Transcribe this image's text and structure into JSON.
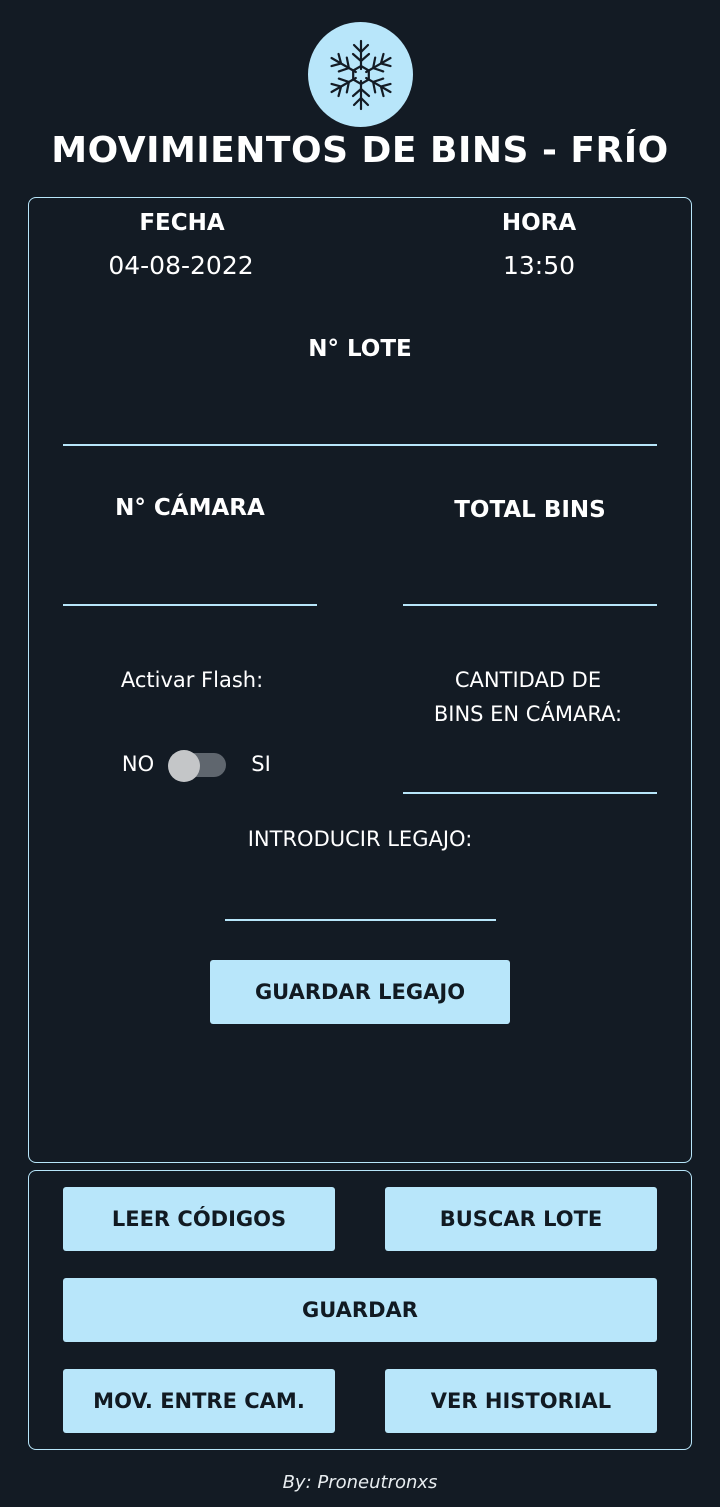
{
  "header": {
    "logo_icon": "snowflake-icon",
    "title": "MOVIMIENTOS DE BINS - FRÍO"
  },
  "form": {
    "fecha_label": "FECHA",
    "fecha_value": "04-08-2022",
    "hora_label": "HORA",
    "hora_value": "13:50",
    "lote_label": "N° LOTE",
    "lote_value": "",
    "camara_label": "N° CÁMARA",
    "camara_value": "",
    "total_bins_label": "TOTAL BINS",
    "total_bins_value": "",
    "flash_label": "Activar Flash:",
    "flash_off": "NO",
    "flash_on": "SI",
    "flash_enabled": false,
    "cantidad_label_line1": "CANTIDAD DE",
    "cantidad_label_line2": "BINS EN CÁMARA:",
    "cantidad_value": "",
    "legajo_label": "INTRODUCIR LEGAJO:",
    "legajo_value": "",
    "guardar_legajo": "GUARDAR LEGAJO"
  },
  "actions": {
    "leer_codigos": "LEER CÓDIGOS",
    "buscar_lote": "BUSCAR LOTE",
    "guardar": "GUARDAR",
    "mov_entre_cam": "MOV. ENTRE CAM.",
    "ver_historial": "VER HISTORIAL"
  },
  "footer": {
    "credit": "By: Proneutronxs"
  },
  "colors": {
    "background": "#131b24",
    "accent": "#b8e6fa",
    "button_text": "#111a22"
  }
}
